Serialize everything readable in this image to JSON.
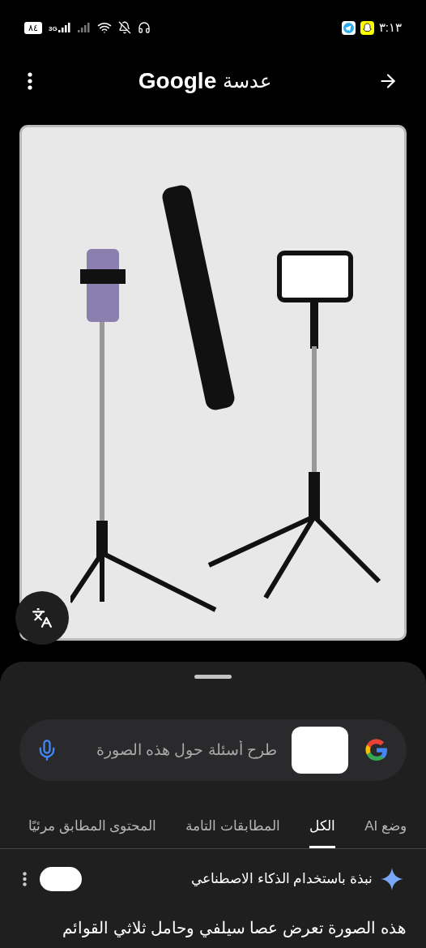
{
  "status_bar": {
    "time": "٣:١٣",
    "battery": "٨٤",
    "network": "3G"
  },
  "header": {
    "title_brand": "Google",
    "title_word": "عدسة"
  },
  "search": {
    "placeholder": "طرح أسئلة حول هذه الصورة"
  },
  "tabs": [
    {
      "label": "وضع AI",
      "selected": false
    },
    {
      "label": "الكل",
      "selected": true
    },
    {
      "label": "المطابقات التامة",
      "selected": false
    },
    {
      "label": "المحتوى المطابق مرئيًا",
      "selected": false
    }
  ],
  "ai_overview": {
    "title": "نبذة باستخدام الذكاء الاصطناعي",
    "text": "هذه الصورة تعرض عصا سيلفي وحامل ثلاثي القوائم"
  }
}
